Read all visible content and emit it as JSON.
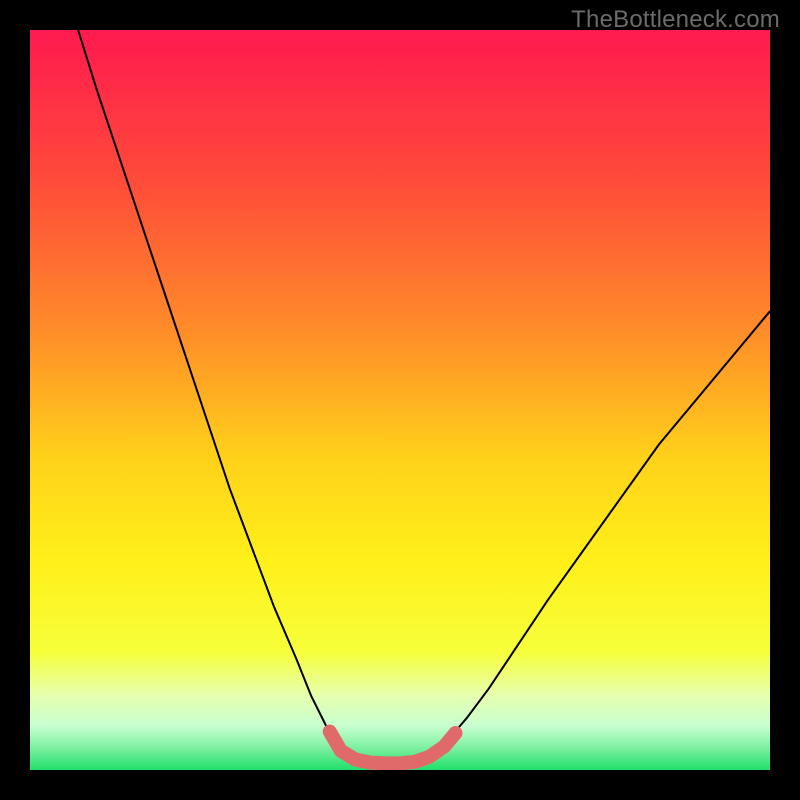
{
  "watermark": "TheBottleneck.com",
  "chart_data": {
    "type": "line",
    "title": "",
    "xlabel": "",
    "ylabel": "",
    "xlim": [
      0,
      100
    ],
    "ylim": [
      0,
      100
    ],
    "gradient_stops": [
      {
        "offset": 0,
        "color": "#ff1a4f"
      },
      {
        "offset": 20,
        "color": "#ff4a3a"
      },
      {
        "offset": 40,
        "color": "#ff8a2a"
      },
      {
        "offset": 58,
        "color": "#ffd21a"
      },
      {
        "offset": 72,
        "color": "#fff01a"
      },
      {
        "offset": 84,
        "color": "#f6ff3a"
      },
      {
        "offset": 90,
        "color": "#e6ffb0"
      },
      {
        "offset": 94,
        "color": "#c8ffd0"
      },
      {
        "offset": 97,
        "color": "#7ef0a0"
      },
      {
        "offset": 100,
        "color": "#1fe06a"
      }
    ],
    "series": [
      {
        "name": "bottleneck-curve",
        "stroke": "#000000",
        "stroke_width": 2,
        "points": [
          {
            "x": 6.5,
            "y": 100
          },
          {
            "x": 9,
            "y": 92
          },
          {
            "x": 12,
            "y": 83
          },
          {
            "x": 15,
            "y": 74
          },
          {
            "x": 18,
            "y": 65
          },
          {
            "x": 21,
            "y": 56
          },
          {
            "x": 24,
            "y": 47
          },
          {
            "x": 27,
            "y": 38
          },
          {
            "x": 30,
            "y": 30
          },
          {
            "x": 33,
            "y": 22
          },
          {
            "x": 36,
            "y": 15
          },
          {
            "x": 38,
            "y": 10
          },
          {
            "x": 40,
            "y": 6
          },
          {
            "x": 42,
            "y": 3
          },
          {
            "x": 44,
            "y": 1.2
          },
          {
            "x": 46,
            "y": 0.6
          },
          {
            "x": 48,
            "y": 0.5
          },
          {
            "x": 50,
            "y": 0.5
          },
          {
            "x": 52,
            "y": 0.7
          },
          {
            "x": 54,
            "y": 1.5
          },
          {
            "x": 56,
            "y": 3.5
          },
          {
            "x": 59,
            "y": 7
          },
          {
            "x": 62,
            "y": 11
          },
          {
            "x": 66,
            "y": 17
          },
          {
            "x": 70,
            "y": 23
          },
          {
            "x": 75,
            "y": 30
          },
          {
            "x": 80,
            "y": 37
          },
          {
            "x": 85,
            "y": 44
          },
          {
            "x": 90,
            "y": 50
          },
          {
            "x": 95,
            "y": 56
          },
          {
            "x": 100,
            "y": 62
          }
        ]
      },
      {
        "name": "valley-highlight",
        "stroke": "#e06a6a",
        "stroke_width": 14,
        "linecap": "round",
        "points": [
          {
            "x": 40.5,
            "y": 5.2
          },
          {
            "x": 42,
            "y": 2.6
          },
          {
            "x": 44,
            "y": 1.4
          },
          {
            "x": 46,
            "y": 1.0
          },
          {
            "x": 48,
            "y": 0.9
          },
          {
            "x": 50,
            "y": 0.9
          },
          {
            "x": 52,
            "y": 1.1
          },
          {
            "x": 54,
            "y": 1.8
          },
          {
            "x": 56,
            "y": 3.2
          },
          {
            "x": 57.5,
            "y": 5.0
          }
        ]
      }
    ]
  }
}
